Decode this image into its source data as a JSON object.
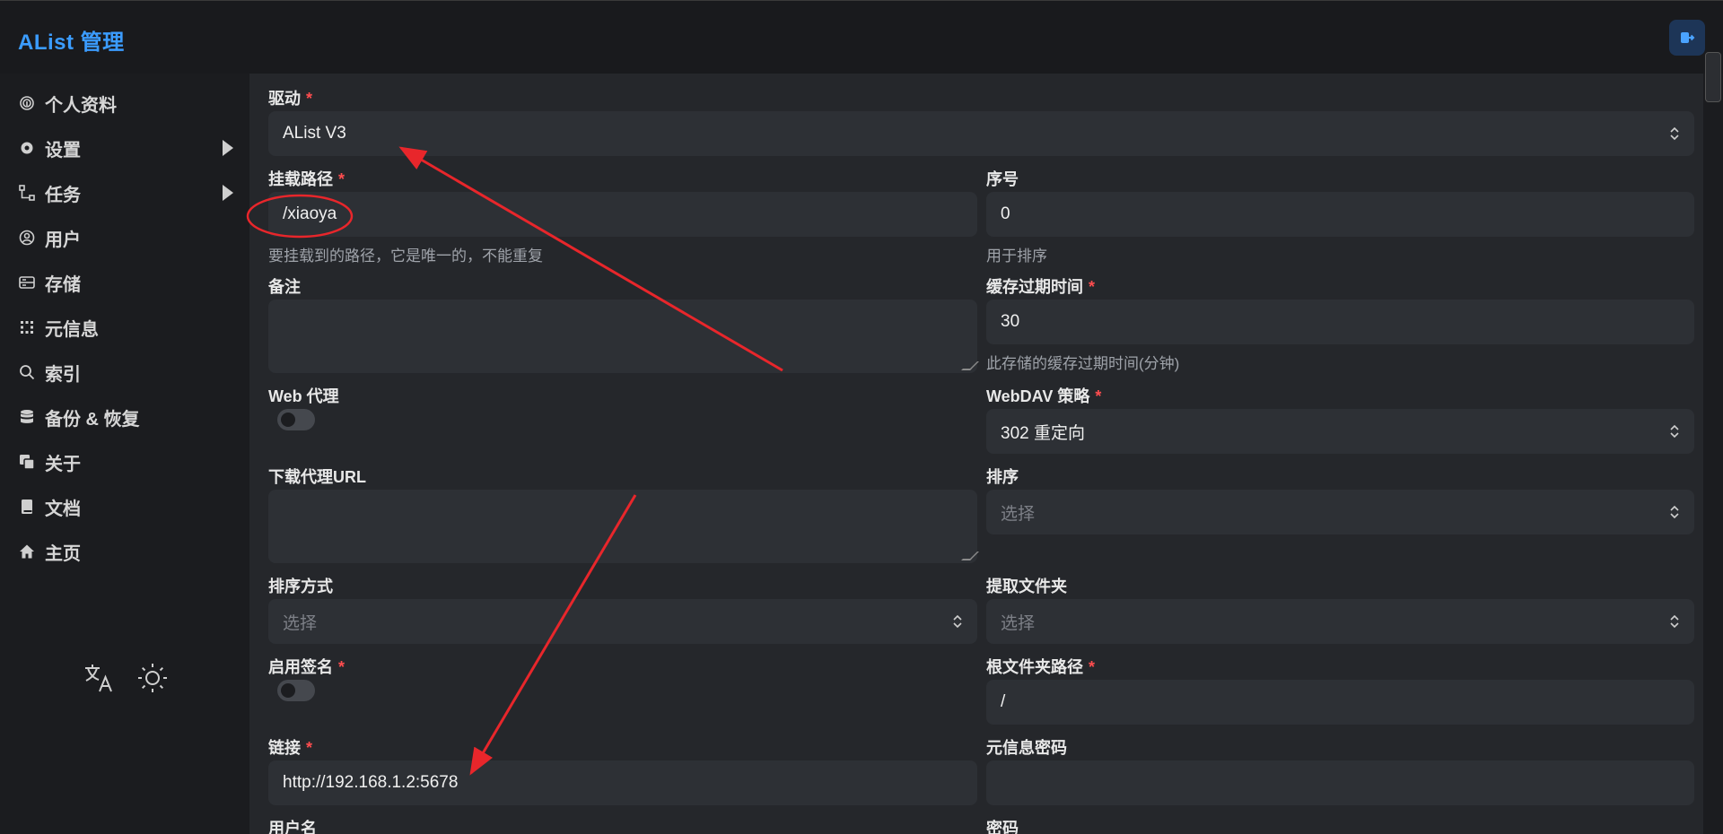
{
  "app": {
    "title": "AList 管理"
  },
  "sidebar": {
    "items": [
      {
        "label": "个人资料",
        "icon": "fingerprint-icon"
      },
      {
        "label": "设置",
        "icon": "gear-icon"
      },
      {
        "label": "任务",
        "icon": "task-flow-icon"
      },
      {
        "label": "用户",
        "icon": "user-circle-icon"
      },
      {
        "label": "存储",
        "icon": "storage-icon"
      },
      {
        "label": "元信息",
        "icon": "meta-grid-icon"
      },
      {
        "label": "索引",
        "icon": "search-icon"
      },
      {
        "label": "备份 & 恢复",
        "icon": "database-icon"
      },
      {
        "label": "关于",
        "icon": "copy-icon"
      },
      {
        "label": "文档",
        "icon": "book-icon"
      },
      {
        "label": "主页",
        "icon": "home-icon"
      }
    ]
  },
  "form": {
    "driver": {
      "label": "驱动",
      "value": "AList V3"
    },
    "mount_path": {
      "label": "挂载路径",
      "value": "/xiaoya",
      "help": "要挂载到的路径，它是唯一的，不能重复"
    },
    "order": {
      "label": "序号",
      "value": "0",
      "help": "用于排序"
    },
    "remark": {
      "label": "备注"
    },
    "cache_expiration": {
      "label": "缓存过期时间",
      "value": "30",
      "help": "此存储的缓存过期时间(分钟)"
    },
    "web_proxy": {
      "label": "Web 代理",
      "enabled": false
    },
    "webdav_policy": {
      "label": "WebDAV 策略",
      "value": "302 重定向"
    },
    "down_proxy_url": {
      "label": "下载代理URL"
    },
    "order_by": {
      "label": "排序",
      "placeholder": "选择"
    },
    "order_direction": {
      "label": "排序方式",
      "placeholder": "选择"
    },
    "extract_folder": {
      "label": "提取文件夹",
      "placeholder": "选择"
    },
    "enable_sign": {
      "label": "启用签名",
      "enabled": false
    },
    "root_folder_path": {
      "label": "根文件夹路径",
      "value": "/"
    },
    "url": {
      "label": "链接",
      "value": "http://192.168.1.2:5678"
    },
    "meta_password": {
      "label": "元信息密码",
      "value": ""
    },
    "username": {
      "label": "用户名"
    },
    "password": {
      "label": "密码"
    }
  },
  "colors": {
    "accent": "#3b9cff",
    "required": "#ff4d4f",
    "annotation": "#e8262b"
  }
}
